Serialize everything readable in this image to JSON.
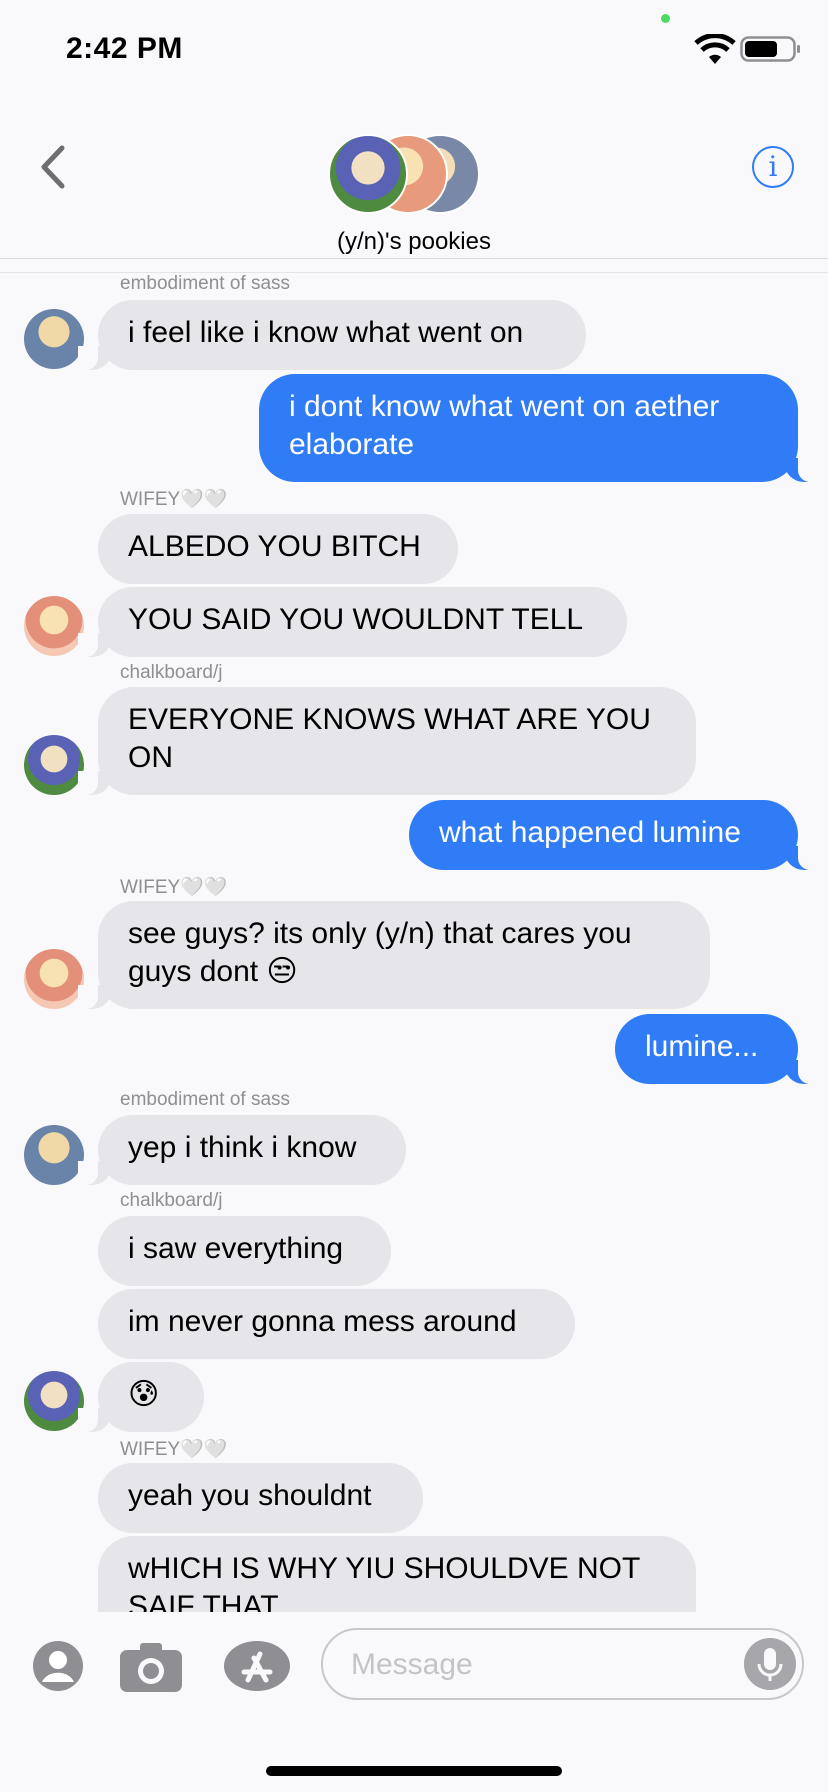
{
  "status": {
    "time": "2:42 PM"
  },
  "header": {
    "group_name": "(y/n)'s pookies",
    "info_symbol": "i"
  },
  "messages": {
    "s1": "embodiment of sass",
    "m1": "i feel like i know what went on",
    "m2": "i dont know what went on aether elaborate",
    "s2": "WIFEY🤍🤍",
    "m3": "ALBEDO YOU BITCH",
    "m4": "YOU SAID YOU WOULDNT TELL",
    "s3": "chalkboard/j",
    "m5": "EVERYONE KNOWS WHAT ARE YOU ON",
    "m6": "what happened lumine",
    "s4": "WIFEY🤍🤍",
    "m7": "see guys? its only (y/n) that cares you guys dont 😒",
    "m8": "lumine...",
    "s5": "embodiment of sass",
    "m9": "yep i think i know",
    "s6": "chalkboard/j",
    "m10": "i saw everything",
    "m11": "im never gonna mess around",
    "m12": "😰",
    "s7": "WIFEY🤍🤍",
    "m13": "yeah you shouldnt",
    "m14": "wHICH IS WHY YIU SHOULDVE NOT SAIF THAT"
  },
  "composer": {
    "placeholder": "Message"
  },
  "colors": {
    "accent": "#2f7cf6",
    "incoming": "#e5e5ea",
    "background": "#f9f9fb"
  }
}
